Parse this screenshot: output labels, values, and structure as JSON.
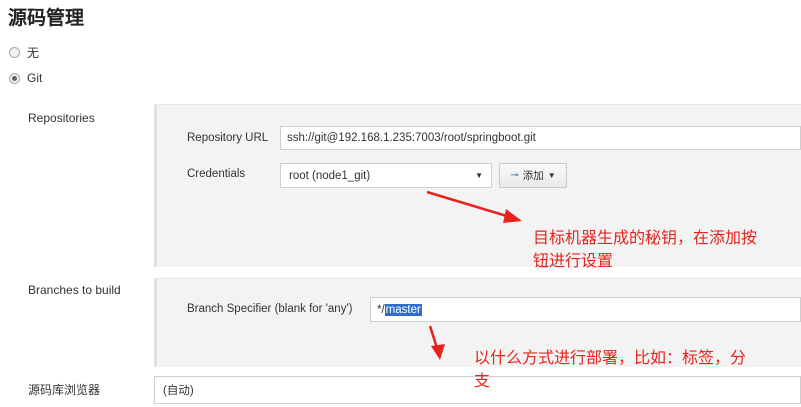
{
  "section_title": "源码管理",
  "scm_options": [
    {
      "label": "无",
      "checked": false
    },
    {
      "label": "Git",
      "checked": true
    }
  ],
  "repositories": {
    "section_label": "Repositories",
    "url_label": "Repository URL",
    "url_value": "ssh://git@192.168.1.235:7003/root/springboot.git",
    "credentials_label": "Credentials",
    "credentials_value": "root (node1_git)",
    "add_button_label": "添加"
  },
  "branches": {
    "section_label": "Branches to build",
    "specifier_label": "Branch Specifier (blank for 'any')",
    "specifier_prefix": "*/",
    "specifier_selected": "master"
  },
  "browser": {
    "label": "源码库浏览器",
    "value": "(自动)"
  },
  "annotations": {
    "credentials_note_line1": "目标机器生成的秘钥，在添加按",
    "credentials_note_line2": "钮进行设置",
    "branch_note_line1": "以什么方式进行部署，比如：标签，分",
    "branch_note_line2": "支"
  },
  "colors": {
    "annotation": "#e8231e",
    "selection": "#2f6fcb"
  }
}
